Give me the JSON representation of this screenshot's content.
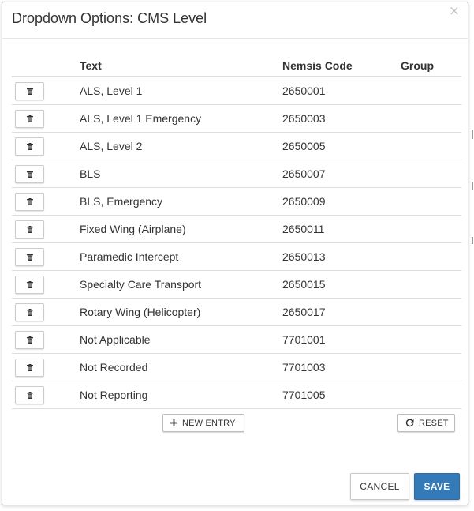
{
  "dialog": {
    "title": "Dropdown Options: CMS Level",
    "close_glyph": "×"
  },
  "table": {
    "headers": {
      "text": "Text",
      "code": "Nemsis Code",
      "group": "Group"
    },
    "rows": [
      {
        "text": "ALS, Level 1",
        "code": "2650001",
        "group": ""
      },
      {
        "text": "ALS, Level 1 Emergency",
        "code": "2650003",
        "group": ""
      },
      {
        "text": "ALS, Level 2",
        "code": "2650005",
        "group": ""
      },
      {
        "text": "BLS",
        "code": "2650007",
        "group": ""
      },
      {
        "text": "BLS, Emergency",
        "code": "2650009",
        "group": ""
      },
      {
        "text": "Fixed Wing (Airplane)",
        "code": "2650011",
        "group": ""
      },
      {
        "text": "Paramedic Intercept",
        "code": "2650013",
        "group": ""
      },
      {
        "text": "Specialty Care Transport",
        "code": "2650015",
        "group": ""
      },
      {
        "text": "Rotary Wing (Helicopter)",
        "code": "2650017",
        "group": ""
      },
      {
        "text": "Not Applicable",
        "code": "7701001",
        "group": ""
      },
      {
        "text": "Not Recorded",
        "code": "7701003",
        "group": ""
      },
      {
        "text": "Not Reporting",
        "code": "7701005",
        "group": ""
      }
    ],
    "delete_icon": "trash-icon"
  },
  "actions": {
    "new_entry_label": "NEW ENTRY",
    "new_entry_icon": "plus-icon",
    "reset_label": "RESET",
    "reset_icon": "refresh-icon"
  },
  "footer": {
    "cancel_label": "CANCEL",
    "save_label": "SAVE"
  },
  "colors": {
    "primary": "#337ab7",
    "border": "#dddddd",
    "text": "#333333"
  }
}
